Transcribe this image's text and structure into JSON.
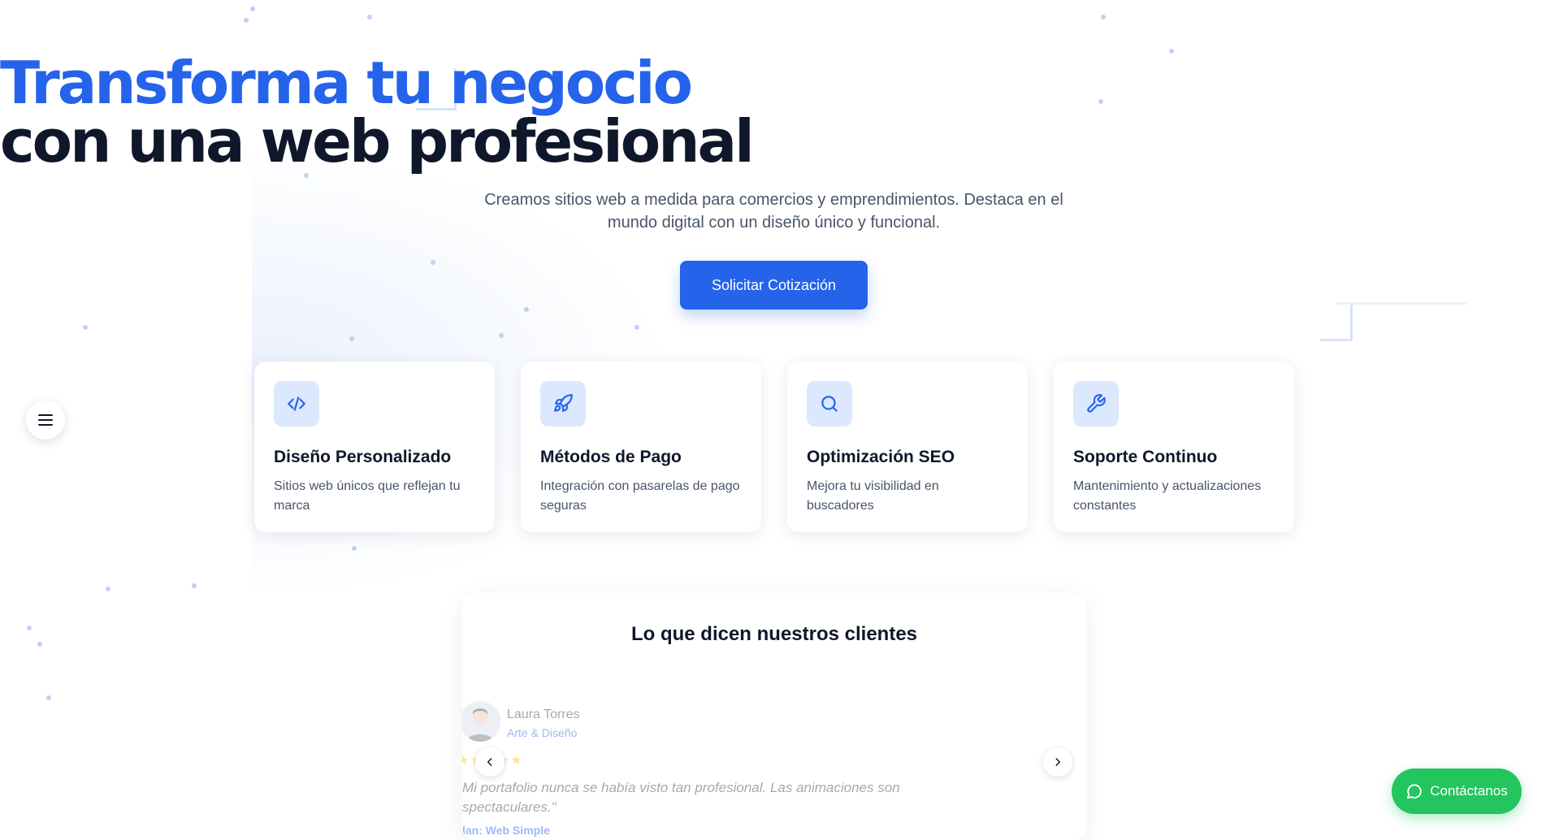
{
  "hero": {
    "title_line1": "Transforma tu negocio",
    "title_line2": "con una web profesional",
    "subtitle": "Creamos sitios web a medida para comercios y emprendimientos. Destaca en el mundo digital con un diseño único y funcional.",
    "cta_label": "Solicitar Cotización"
  },
  "features": [
    {
      "icon": "code-icon",
      "title": "Diseño Personalizado",
      "description": "Sitios web únicos que reflejan tu marca"
    },
    {
      "icon": "rocket-icon",
      "title": "Métodos de Pago",
      "description": "Integración con pasarelas de pago seguras"
    },
    {
      "icon": "search-icon",
      "title": "Optimización SEO",
      "description": "Mejora tu visibilidad en buscadores"
    },
    {
      "icon": "wrench-icon",
      "title": "Soporte Continuo",
      "description": "Mantenimiento y actualizaciones constantes"
    }
  ],
  "testimonials": {
    "title": "Lo que dicen nuestros clientes",
    "current": {
      "name": "Laura Torres",
      "role": "Arte & Diseño",
      "stars": "★★★★★",
      "quote": "Mi portafolio nunca se había visto tan profesional. Las animaciones son spectaculares.\"",
      "attribution": "lan: Web Simple"
    }
  },
  "menu": {
    "icon": "hamburger-menu-icon"
  },
  "contact": {
    "label": "Contáctanos",
    "icon": "chat-bubble-icon"
  },
  "colors": {
    "primary": "#2563eb",
    "dark": "#0f172a",
    "muted": "#475569",
    "icon_bg": "#dbe8fd",
    "whatsapp_green": "#22c55e"
  }
}
